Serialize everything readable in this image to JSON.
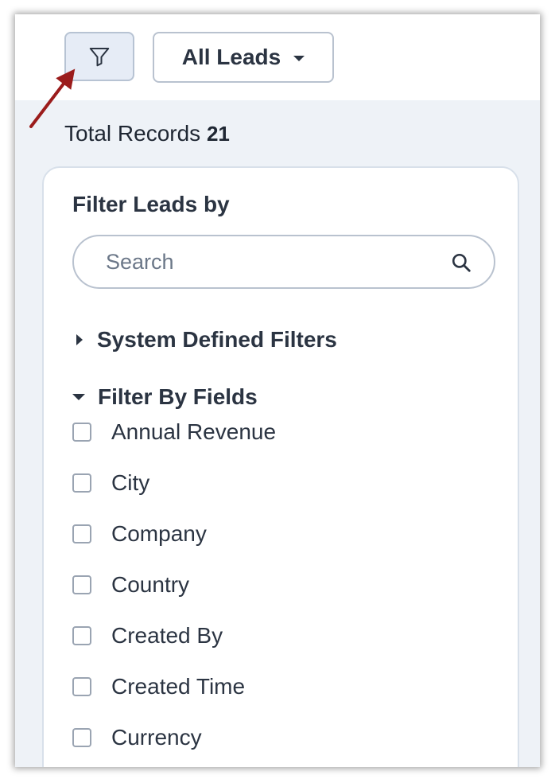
{
  "toolbar": {
    "filter_icon": "filter-funnel-icon",
    "view_selector_label": "All Leads",
    "view_selector_icon": "caret-down-icon"
  },
  "summary": {
    "label": "Total Records",
    "count": "21"
  },
  "filter_panel": {
    "title": "Filter Leads by",
    "search": {
      "placeholder": "Search",
      "value": "",
      "icon": "search-icon"
    },
    "sections": [
      {
        "label": "System Defined Filters",
        "expanded": false,
        "icon": "caret-right-icon"
      },
      {
        "label": "Filter By Fields",
        "expanded": true,
        "icon": "caret-down-icon"
      }
    ],
    "fields": [
      {
        "label": "Annual Revenue",
        "checked": false
      },
      {
        "label": "City",
        "checked": false
      },
      {
        "label": "Company",
        "checked": false
      },
      {
        "label": "Country",
        "checked": false
      },
      {
        "label": "Created By",
        "checked": false
      },
      {
        "label": "Created Time",
        "checked": false
      },
      {
        "label": "Currency",
        "checked": false
      }
    ]
  },
  "annotation": {
    "arrow_color": "#9b1c1c",
    "arrow_target": "filter-button"
  },
  "colors": {
    "page_background": "#eef2f7",
    "text_primary": "#2b3442",
    "border": "#b9c2cf",
    "filter_button_bg": "#e6ecf6"
  }
}
